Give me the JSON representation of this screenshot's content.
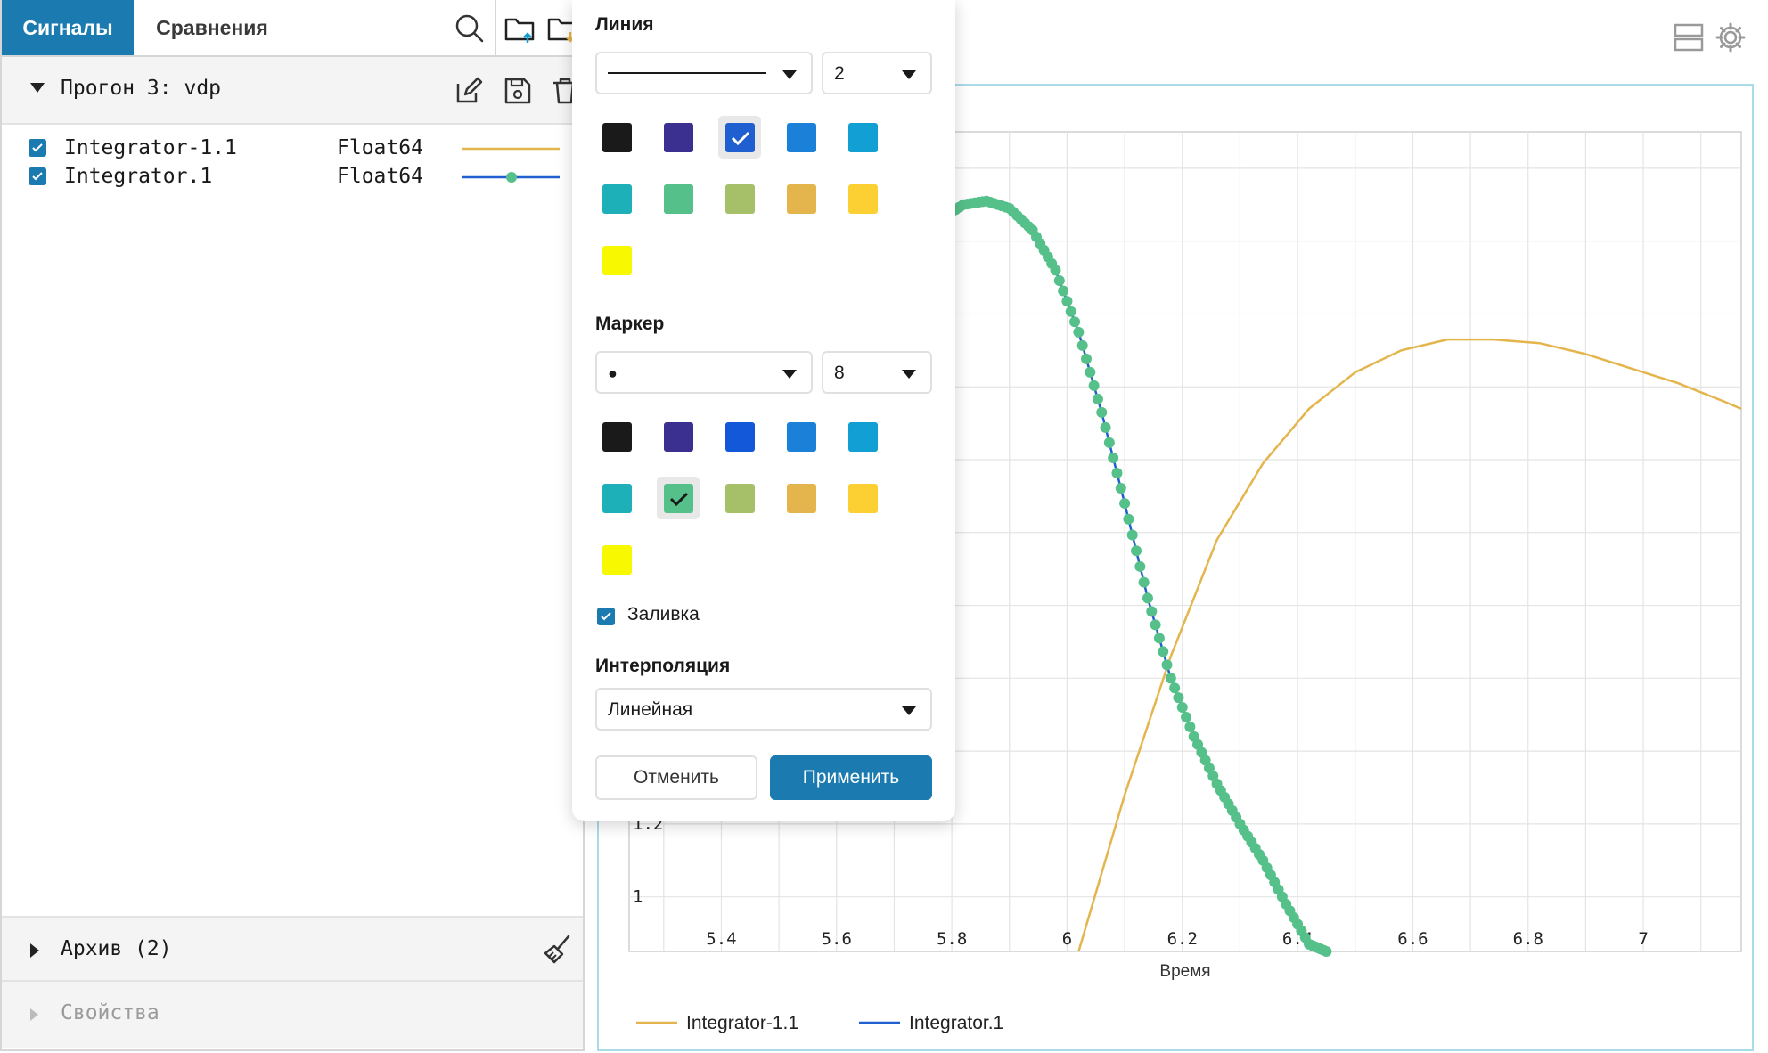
{
  "tabs": {
    "signals": "Сигналы",
    "comparisons": "Сравнения"
  },
  "run": {
    "title": "Прогон 3: vdp"
  },
  "signals": [
    {
      "name": "Integrator-1.1",
      "type": "Float64",
      "color": "#e3b54c",
      "checked": true
    },
    {
      "name": "Integrator.1",
      "type": "Float64",
      "color": "#1f5fcf",
      "marker_color": "#55c08a",
      "checked": true
    }
  ],
  "archive": {
    "title": "Архив (2)"
  },
  "properties": {
    "title": "Свойства"
  },
  "popup": {
    "line_label": "Линия",
    "line_width": "2",
    "marker_label": "Маркер",
    "marker_size": "8",
    "marker_symbol": "●",
    "fill_label": "Заливка",
    "interp_label": "Интерполяция",
    "interp_value": "Линейная",
    "cancel": "Отменить",
    "apply": "Применить",
    "line_colors": [
      "#1a1a1a",
      "#3b2f8f",
      "#1f5fcf",
      "#1a80d8",
      "#12a0d4",
      "#1db0b8",
      "#55c08a",
      "#a6c06a",
      "#e3b54c",
      "#fcd033",
      "#f8f800"
    ],
    "line_selected": 2,
    "marker_colors": [
      "#1a1a1a",
      "#3b2f8f",
      "#1258d8",
      "#1a80d8",
      "#12a0d4",
      "#1db0b8",
      "#55c08a",
      "#a6c06a",
      "#e3b54c",
      "#fcd033",
      "#f8f800"
    ],
    "marker_selected": 6
  },
  "chart_data": {
    "type": "line",
    "xlabel": "Время",
    "x_ticks": [
      "5.4",
      "5.6",
      "5.8",
      "6",
      "6.2",
      "6.4",
      "6.6",
      "6.8",
      "7"
    ],
    "y_ticks_visible": [
      "1",
      "1.2"
    ],
    "xlim": [
      5.24,
      7.17
    ],
    "ylim": [
      0.85,
      3.1
    ],
    "grid": true,
    "legend": "bottom-left",
    "series": [
      {
        "name": "Integrator-1.1",
        "color": "#e3b54c",
        "x": [
          6.02,
          6.1,
          6.18,
          6.26,
          6.34,
          6.42,
          6.5,
          6.58,
          6.66,
          6.74,
          6.82,
          6.9,
          6.98,
          7.06,
          7.14,
          7.17
        ],
        "y": [
          0.85,
          1.28,
          1.66,
          1.98,
          2.19,
          2.34,
          2.44,
          2.5,
          2.53,
          2.53,
          2.52,
          2.49,
          2.45,
          2.41,
          2.36,
          2.34
        ]
      },
      {
        "name": "Integrator.1",
        "color": "#1f5fcf",
        "marker_color": "#55c08a",
        "x": [
          5.74,
          5.78,
          5.82,
          5.86,
          5.9,
          5.94,
          5.98,
          6.02,
          6.06,
          6.1,
          6.14,
          6.18,
          6.22,
          6.26,
          6.3,
          6.34,
          6.38,
          6.42,
          6.45
        ],
        "y": [
          2.79,
          2.86,
          2.9,
          2.91,
          2.89,
          2.83,
          2.72,
          2.55,
          2.33,
          2.08,
          1.82,
          1.6,
          1.44,
          1.31,
          1.2,
          1.1,
          0.98,
          0.87,
          0.85
        ]
      }
    ]
  },
  "legend": {
    "item1": "Integrator-1.1",
    "item2": "Integrator.1"
  },
  "colors": {
    "accent": "#1b7bb0",
    "plot_border": "#a9dbe8"
  }
}
